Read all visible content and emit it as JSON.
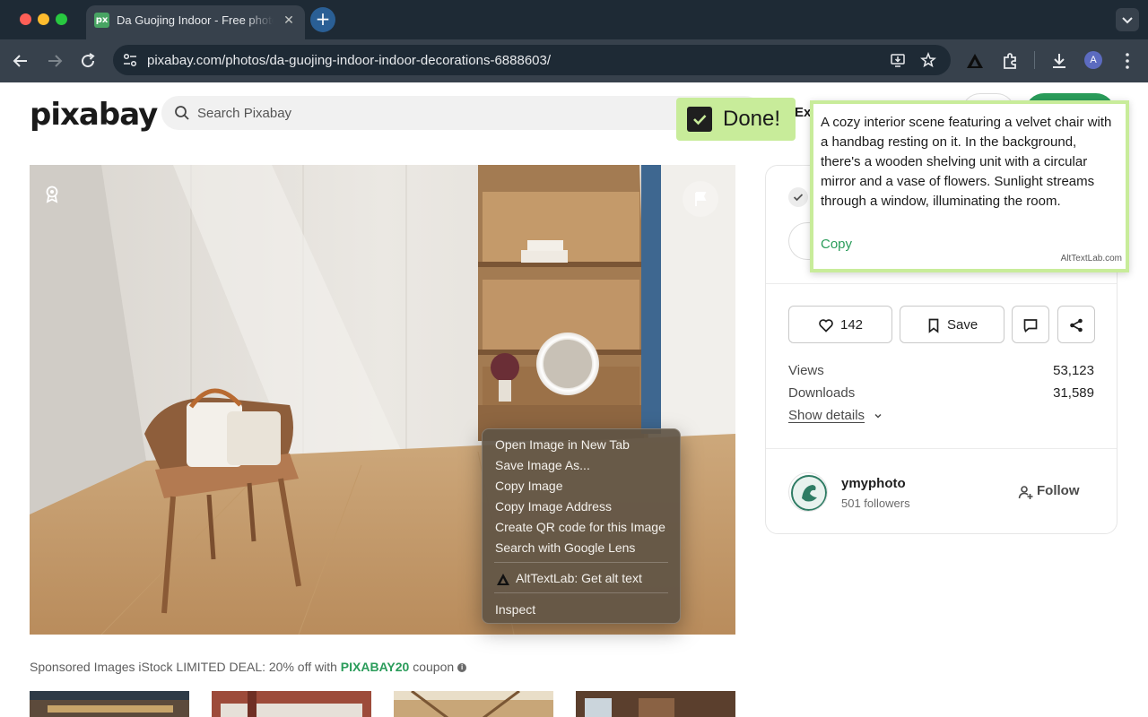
{
  "browser": {
    "tab_title": "Da Guojing Indoor - Free photo",
    "tab_favicon_text": "px",
    "url": "pixabay.com/photos/da-guojing-indoor-indoor-decorations-6888603/",
    "profile_initial": "A"
  },
  "header": {
    "logo": "pixabay",
    "search_placeholder": "Search Pixabay",
    "explore_clipped": "Ex"
  },
  "sidebar": {
    "like_count": "142",
    "save_label": "Save",
    "stats": [
      {
        "label": "Views",
        "value": "53,123"
      },
      {
        "label": "Downloads",
        "value": "31,589"
      }
    ],
    "show_details": "Show details",
    "author": {
      "name": "ymyphoto",
      "followers": "501 followers"
    },
    "follow_label": "Follow"
  },
  "sponsored": {
    "prefix": "Sponsored Images iStock LIMITED DEAL: 20% off with ",
    "code": "PIXABAY20",
    "suffix": " coupon"
  },
  "extension": {
    "done_label": "Done!",
    "alt_text": "A cozy interior scene featuring a velvet chair with a handbag resting on it. In the background, there's a wooden shelving unit with a circular mirror and a vase of flowers. Sunlight streams through a window, illuminating the room.",
    "copy_label": "Copy",
    "brand": "AltTextLab.com"
  },
  "context_menu": {
    "items": [
      "Open Image in New Tab",
      "Save Image As...",
      "Copy Image",
      "Copy Image Address",
      "Create QR code for this Image",
      "Search with Google Lens"
    ],
    "extension_item": "AltTextLab: Get alt text",
    "inspect": "Inspect"
  },
  "colors": {
    "accent_green": "#2a9c5a",
    "highlight_green": "#c8ec9a",
    "chrome_dark": "#1e2a35"
  }
}
